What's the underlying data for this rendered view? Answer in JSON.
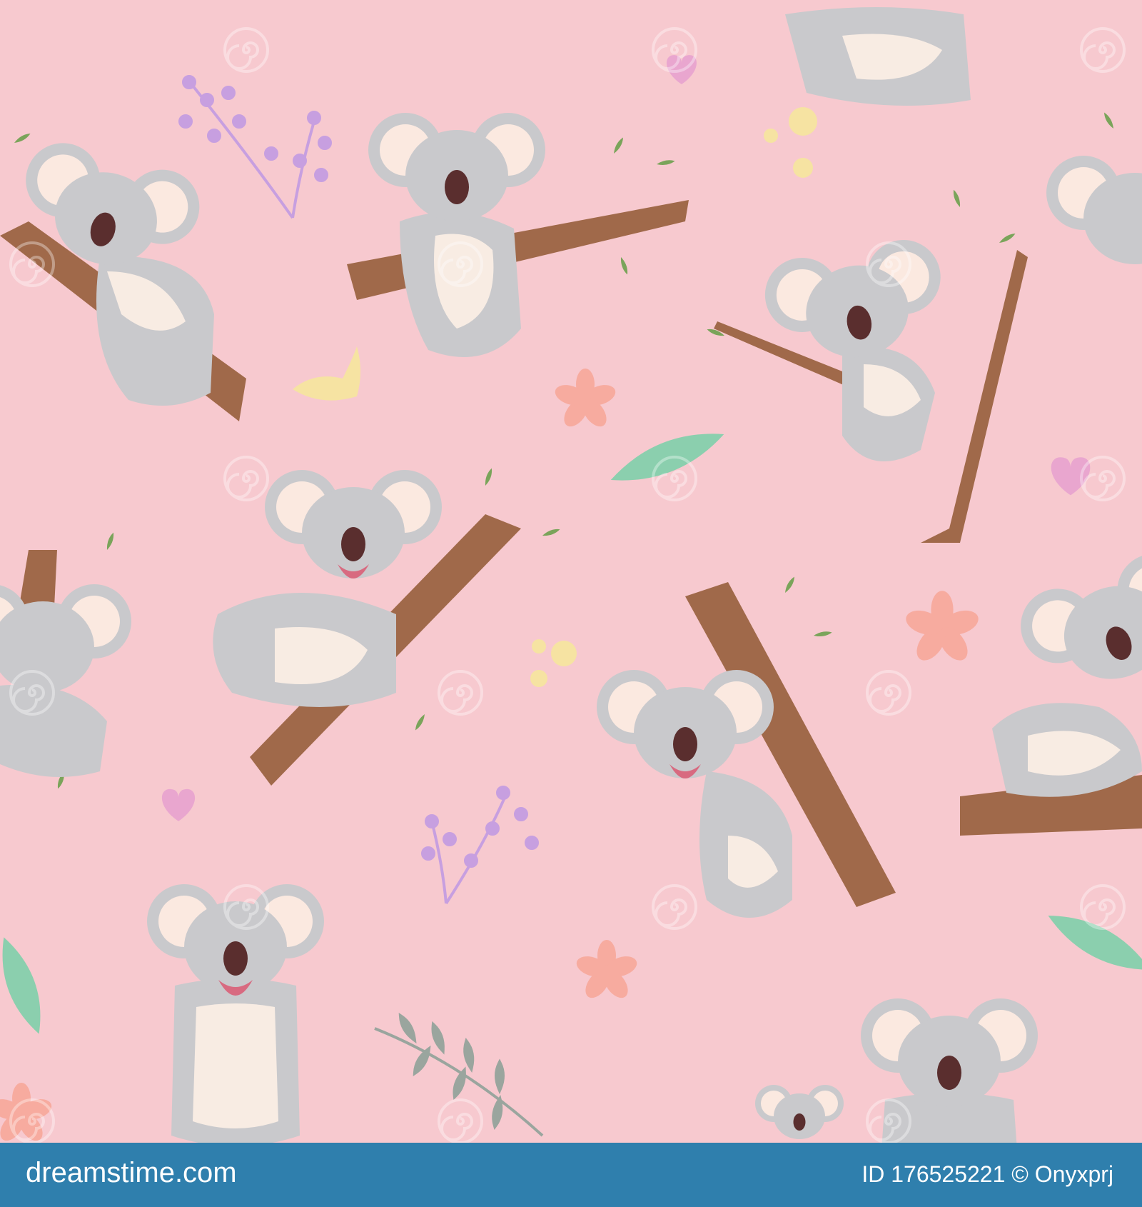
{
  "colors": {
    "background": "#f7c9cf",
    "footer": "#2f7fad",
    "koala_fur": "#c9c9cc",
    "koala_dark": "#a9a9ad",
    "ear_inner": "#fbe9e0",
    "belly": "#f8ece3",
    "nose": "#5a2e2e",
    "mouth": "#d86a80",
    "branch": "#a0694a",
    "branch_light": "#c08a67",
    "leaf": "#8bcfae",
    "leaf_dark": "#7aa45a",
    "flower": "#f7ab9f",
    "heart": "#e9a6cf",
    "berry": "#c79fe0",
    "dot": "#f6e3a2",
    "watermark": "#ffffff"
  },
  "icons": [
    "koala",
    "branch",
    "leaf",
    "flower",
    "heart",
    "berry-sprig",
    "watermark-spiral"
  ],
  "footer": {
    "brand": "dreamstime.com",
    "credit": "ID 176525221 © Onyxprj"
  }
}
